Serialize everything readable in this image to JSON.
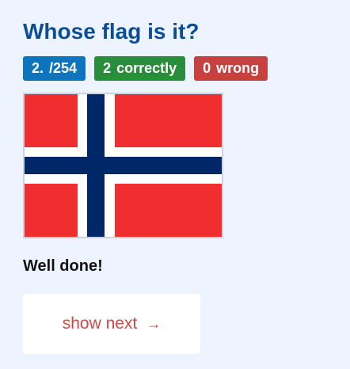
{
  "game": {
    "title": "Whose flag is it?"
  },
  "progress": {
    "current": "2.",
    "separator": "/",
    "total": "254",
    "correct_count": "2",
    "correct_label": "correctly",
    "wrong_count": "0",
    "wrong_label": "wrong"
  },
  "flag": {
    "colors": {
      "field": "#f02d2f",
      "outer_cross": "#ffffff",
      "inner_cross": "#002868"
    }
  },
  "feedback": {
    "message": "Well done!"
  },
  "actions": {
    "next_label": "show next",
    "next_icon": "arrow-right-icon",
    "next_glyph": "→"
  },
  "colors": {
    "background": "#eef4ff",
    "title": "#0a4f95",
    "badge_progress": "#0d75be",
    "badge_correct": "#2a8d3c",
    "badge_wrong": "#c84141",
    "next_text": "#cc4848"
  }
}
